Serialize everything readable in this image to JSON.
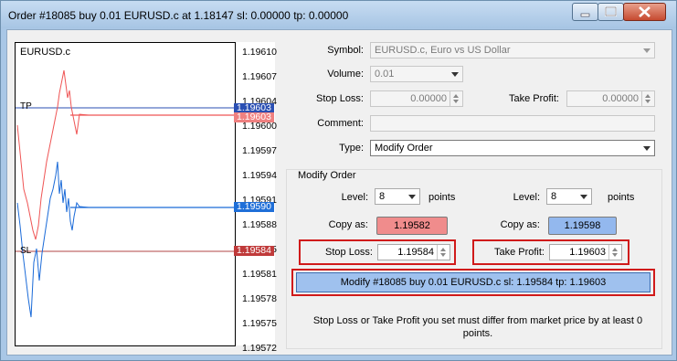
{
  "window": {
    "title": "Order #18085 buy 0.01 EURUSD.c at 1.18147 sl: 0.00000 tp: 0.00000",
    "controls": [
      "minimize-icon",
      "maximize-icon",
      "close-icon"
    ]
  },
  "chart": {
    "symbol": "EURUSD.c",
    "price_ticks": [
      "1.19610",
      "1.19607",
      "1.19604",
      "1.19600",
      "1.19597",
      "1.19594",
      "1.19591",
      "1.19588",
      "1.19585",
      "1.19581",
      "1.19578",
      "1.19575",
      "1.19572"
    ],
    "tp_label": "TP",
    "sl_label": "SL",
    "tags": {
      "tp": "1.19603",
      "tp_copy": "1.19603",
      "bid": "1.19590",
      "sl": "1.19584"
    },
    "colors": {
      "tp_tag": "#2a4fb3",
      "bid_tag": "#1f6fd8",
      "sl_tag": "#c03a3a",
      "red_line": "#ef5555",
      "blue_line": "#1a6ad8",
      "sl_line": "#b04545"
    }
  },
  "form": {
    "symbol_label": "Symbol:",
    "symbol_value": "EURUSD.c, Euro vs US Dollar",
    "volume_label": "Volume:",
    "volume_value": "0.01",
    "stop_loss_label": "Stop Loss:",
    "stop_loss_value": "0.00000",
    "take_profit_label": "Take Profit:",
    "take_profit_value": "0.00000",
    "comment_label": "Comment:",
    "comment_value": "",
    "type_label": "Type:",
    "type_value": "Modify Order"
  },
  "modify": {
    "group_title": "Modify Order",
    "left": {
      "level_label": "Level:",
      "level_value": "8",
      "points_label": "points",
      "copy_label": "Copy as:",
      "copy_value": "1.19582",
      "copy_color": "#f08c8c",
      "sl_label": "Stop Loss:",
      "sl_value": "1.19584"
    },
    "right": {
      "level_label": "Level:",
      "level_value": "8",
      "points_label": "points",
      "copy_label": "Copy as:",
      "copy_value": "1.19598",
      "copy_color": "#93b8ee",
      "tp_label": "Take Profit:",
      "tp_value": "1.19603"
    },
    "modify_button": "Modify #18085 buy 0.01 EURUSD.c sl: 1.19584 tp: 1.19603",
    "note": "Stop Loss or Take Profit you set must differ from market price by at least 0 points."
  }
}
